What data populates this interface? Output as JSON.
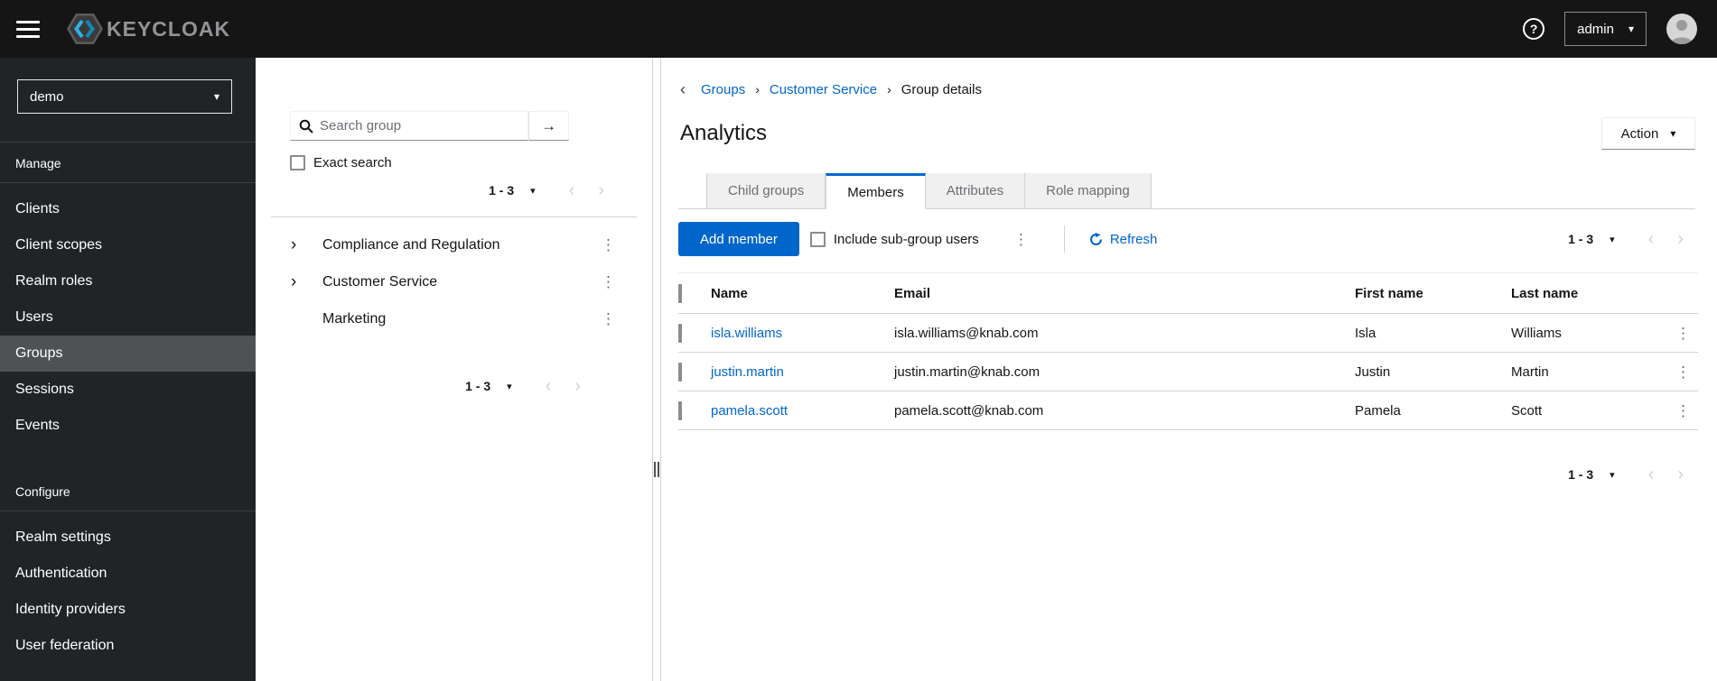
{
  "masthead": {
    "brand_text": "KEYCLOAK",
    "username": "admin"
  },
  "sidebar": {
    "realm": "demo",
    "sections": [
      {
        "label": "Manage",
        "items": [
          {
            "label": "Clients"
          },
          {
            "label": "Client scopes"
          },
          {
            "label": "Realm roles"
          },
          {
            "label": "Users"
          },
          {
            "label": "Groups",
            "selected": true
          },
          {
            "label": "Sessions"
          },
          {
            "label": "Events"
          }
        ]
      },
      {
        "label": "Configure",
        "items": [
          {
            "label": "Realm settings"
          },
          {
            "label": "Authentication"
          },
          {
            "label": "Identity providers"
          },
          {
            "label": "User federation"
          }
        ]
      }
    ]
  },
  "tree_panel": {
    "search_placeholder": "Search group",
    "exact_search_label": "Exact search",
    "pagination_top": {
      "range": "1 - 3"
    },
    "pagination_bottom": {
      "range": "1 - 3"
    },
    "groups": [
      {
        "name": "Compliance and Regulation",
        "expandable": true
      },
      {
        "name": "Customer Service",
        "expandable": true
      },
      {
        "name": "Marketing",
        "expandable": false
      }
    ]
  },
  "main": {
    "breadcrumb": {
      "items": [
        {
          "label": "Groups"
        },
        {
          "label": "Customer Service"
        },
        {
          "label": "Group details"
        }
      ]
    },
    "title": "Analytics",
    "action_label": "Action",
    "tabs": [
      {
        "label": "Child groups"
      },
      {
        "label": "Members",
        "active": true
      },
      {
        "label": "Attributes"
      },
      {
        "label": "Role mapping"
      }
    ],
    "toolbar": {
      "add_member_label": "Add member",
      "include_subgroup_label": "Include sub-group users",
      "refresh_label": "Refresh",
      "pagination": {
        "range": "1 - 3"
      }
    },
    "table": {
      "headers": [
        "Name",
        "Email",
        "First name",
        "Last name"
      ],
      "rows": [
        {
          "name": "isla.williams",
          "email": "isla.williams@knab.com",
          "first_name": "Isla",
          "last_name": "Williams"
        },
        {
          "name": "justin.martin",
          "email": "justin.martin@knab.com",
          "first_name": "Justin",
          "last_name": "Martin"
        },
        {
          "name": "pamela.scott",
          "email": "pamela.scott@knab.com",
          "first_name": "Pamela",
          "last_name": "Scott"
        }
      ]
    },
    "pagination_bottom": {
      "range": "1 - 3"
    }
  },
  "icons": {
    "caret_down": "▾",
    "angle_left": "‹",
    "angle_right": "›",
    "kebab": "⋮",
    "arrow_right": "→",
    "breadcrumb_sep": "›",
    "back": "‹",
    "tree_expand": "›",
    "help": "?"
  },
  "colors": {
    "accent": "#0066cc",
    "link": "#0066cc",
    "masthead_bg": "#151515",
    "sidebar_bg": "#212427",
    "sidebar_selected_bg": "#4f5255",
    "border": "#d2d2d2",
    "muted_text": "#6a6e73",
    "disabled": "#d2d2d2",
    "tab_inactive_bg": "#f0f0f0"
  }
}
